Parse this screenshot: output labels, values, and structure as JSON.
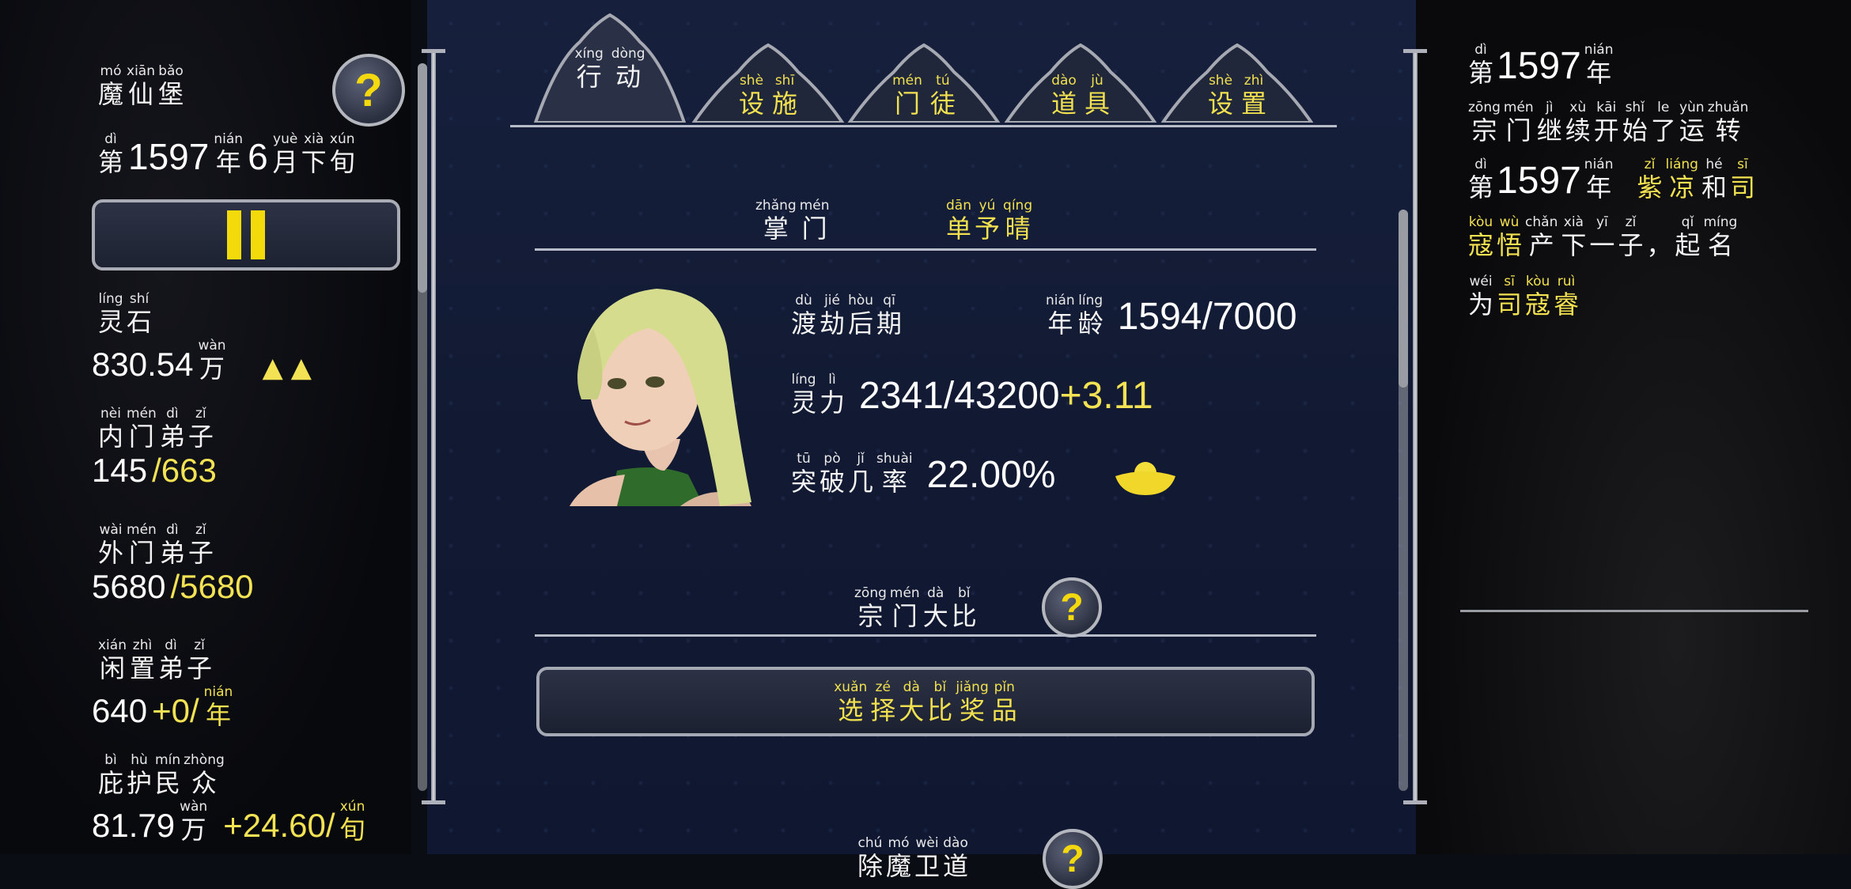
{
  "left": {
    "location": [
      [
        "mó",
        "魔"
      ],
      [
        "xiān",
        "仙"
      ],
      [
        "bǎo",
        "堡"
      ]
    ],
    "date_prefix": [
      [
        "dì",
        "第"
      ]
    ],
    "date_year": "1597",
    "date_year_unit": [
      [
        "nián",
        "年"
      ]
    ],
    "date_month": "6",
    "date_month_unit": [
      [
        "yuè",
        "月"
      ],
      [
        "xià",
        "下"
      ],
      [
        "xún",
        "旬"
      ]
    ],
    "pause_label": "II",
    "stats": [
      {
        "label": [
          [
            "líng",
            "灵"
          ],
          [
            "shí",
            "石"
          ]
        ],
        "value": "830.54",
        "unit": [
          [
            "wàn",
            "万"
          ]
        ],
        "arrows": "▲▲"
      },
      {
        "label": [
          [
            "nèi",
            "内"
          ],
          [
            "mén",
            "门"
          ],
          [
            "dì",
            "弟"
          ],
          [
            "zǐ",
            "子"
          ]
        ],
        "value": "145",
        "value2": "/663"
      },
      {
        "label": [
          [
            "wài",
            "外"
          ],
          [
            "mén",
            "门"
          ],
          [
            "dì",
            "弟"
          ],
          [
            "zǐ",
            "子"
          ]
        ],
        "value": "5680",
        "value2": "/5680"
      },
      {
        "label": [
          [
            "xián",
            "闲"
          ],
          [
            "zhì",
            "置"
          ],
          [
            "dì",
            "弟"
          ],
          [
            "zǐ",
            "子"
          ]
        ],
        "value": "640",
        "value2": "+0/",
        "unit": [
          [
            "nián",
            "年"
          ]
        ]
      },
      {
        "label": [
          [
            "bì",
            "庇"
          ],
          [
            "hù",
            "护"
          ],
          [
            "mín",
            "民"
          ],
          [
            "zhòng",
            "众"
          ]
        ],
        "value": "81.79",
        "unit": [
          [
            "wàn",
            "万"
          ]
        ],
        "value2": "+24.60/",
        "unit2": [
          [
            "xún",
            "旬"
          ]
        ]
      }
    ]
  },
  "tabs": [
    {
      "chars": [
        [
          "xíng",
          "行"
        ],
        [
          "dòng",
          "动"
        ]
      ],
      "active": true
    },
    {
      "chars": [
        [
          "shè",
          "设"
        ],
        [
          "shī",
          "施"
        ]
      ],
      "active": false
    },
    {
      "chars": [
        [
          "mén",
          "门"
        ],
        [
          "tú",
          "徒"
        ]
      ],
      "active": false
    },
    {
      "chars": [
        [
          "dào",
          "道"
        ],
        [
          "jù",
          "具"
        ]
      ],
      "active": false
    },
    {
      "chars": [
        [
          "shè",
          "设"
        ],
        [
          "zhì",
          "置"
        ]
      ],
      "active": false
    }
  ],
  "leader": {
    "label": [
      [
        "zhǎng",
        "掌"
      ],
      [
        "mén",
        "门"
      ]
    ],
    "name": [
      [
        "dān",
        "单"
      ],
      [
        "yú",
        "予"
      ],
      [
        "qíng",
        "晴"
      ]
    ],
    "realm": [
      [
        "dù",
        "渡"
      ],
      [
        "jié",
        "劫"
      ],
      [
        "hòu",
        "后"
      ],
      [
        "qī",
        "期"
      ]
    ],
    "age_label": [
      [
        "nián",
        "年"
      ],
      [
        "líng",
        "龄"
      ]
    ],
    "age": "1594/7000",
    "power_label": [
      [
        "líng",
        "灵"
      ],
      [
        "lì",
        "力"
      ]
    ],
    "power": "2341/43200",
    "power_rate": "+3.11",
    "break_label": [
      [
        "tū",
        "突"
      ],
      [
        "pò",
        "破"
      ],
      [
        "jǐ",
        "几"
      ],
      [
        "shuài",
        "率"
      ]
    ],
    "break_value": "22.00%"
  },
  "contest": {
    "title": [
      [
        "zōng",
        "宗"
      ],
      [
        "mén",
        "门"
      ],
      [
        "dà",
        "大"
      ],
      [
        "bǐ",
        "比"
      ]
    ],
    "button": [
      [
        "xuǎn",
        "选"
      ],
      [
        "zé",
        "择"
      ],
      [
        "dà",
        "大"
      ],
      [
        "bǐ",
        "比"
      ],
      [
        "jiǎng",
        "奖"
      ],
      [
        "pǐn",
        "品"
      ]
    ],
    "next_title": [
      [
        "chú",
        "除"
      ],
      [
        "mó",
        "魔"
      ],
      [
        "wèi",
        "卫"
      ],
      [
        "dào",
        "道"
      ]
    ]
  },
  "help_label": "?",
  "log": {
    "entries": [
      {
        "prefix": [
          [
            "dì",
            "第"
          ]
        ],
        "year": "1597",
        "suffix": [
          [
            "nián",
            "年"
          ]
        ]
      },
      {
        "line": [
          [
            "zōng",
            "宗"
          ],
          [
            "mén",
            "门"
          ],
          [
            "jì",
            "继"
          ],
          [
            "xù",
            "续"
          ],
          [
            "kāi",
            "开"
          ],
          [
            "shǐ",
            "始"
          ],
          [
            "le",
            "了"
          ],
          [
            "yùn",
            "运"
          ],
          [
            "zhuǎn",
            "转"
          ]
        ]
      },
      {
        "prefix": [
          [
            "dì",
            "第"
          ]
        ],
        "year": "1597",
        "suffix": [
          [
            "nián",
            "年"
          ]
        ],
        "yellow": [
          [
            "zǐ",
            "紫"
          ],
          [
            "liáng",
            "凉"
          ]
        ],
        "mid": [
          [
            "hé",
            "和"
          ]
        ],
        "yellow2": [
          [
            "sī",
            "司"
          ]
        ]
      },
      {
        "yellow": [
          [
            "kòu",
            "寇"
          ],
          [
            "wù",
            "悟"
          ]
        ],
        "line": [
          [
            "chǎn",
            "产"
          ],
          [
            "xià",
            "下"
          ],
          [
            "yī",
            "一"
          ],
          [
            "zǐ",
            "子"
          ],
          [
            "",
            "，"
          ],
          [
            "qǐ",
            "起"
          ],
          [
            "míng",
            "名"
          ]
        ]
      },
      {
        "line": [
          [
            "wéi",
            "为"
          ]
        ],
        "yellow": [
          [
            "sī",
            "司"
          ],
          [
            "kòu",
            "寇"
          ],
          [
            "ruì",
            "睿"
          ]
        ]
      }
    ]
  },
  "colors": {
    "accent_yellow": "#f3e253",
    "panel_bg": "#121a33",
    "text": "#f2f2f2"
  }
}
